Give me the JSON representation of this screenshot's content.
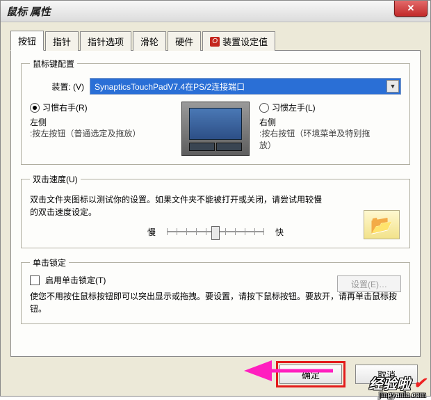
{
  "window": {
    "title": "鼠标 属性"
  },
  "tabs": {
    "buttons": "按钮",
    "pointer": "指针",
    "pointer_options": "指针选项",
    "wheel": "滑轮",
    "hardware": "硬件",
    "device_settings": "装置设定值"
  },
  "config": {
    "legend": "鼠标键配置",
    "device_label": "装置: (V)",
    "device_value": "SynapticsTouchPadV7.4在PS/2连接端口",
    "right_handed": "习惯右手(R)",
    "left_handed": "习惯左手(L)",
    "left_side": "左侧",
    "left_desc": ":按左按钮（普通选定及拖放）",
    "right_side": "右侧",
    "right_desc": ":按右按钮（环境菜单及特别拖放）"
  },
  "dblclick": {
    "legend": "双击速度(U)",
    "text": "双击文件夹图标以测试你的设置。如果文件夹不能被打开或关闭，请尝试用较慢的双击速度设定。",
    "slow": "慢",
    "fast": "快"
  },
  "clicklock": {
    "legend": "单击锁定",
    "checkbox_label": "启用单击锁定(T)",
    "settings_btn": "设置(E)…",
    "desc": "使您不用按住鼠标按钮即可以突出显示或拖拽。要设置，请按下鼠标按钮。要放开，请再单击鼠标按钮。"
  },
  "footer": {
    "ok": "确定",
    "cancel": "取消"
  },
  "watermark": {
    "main": "经验啦",
    "sub": "jingyanla.com"
  }
}
